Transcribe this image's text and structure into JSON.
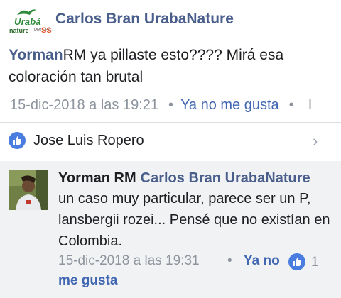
{
  "header": {
    "logo": {
      "word1": "Urabá",
      "word2": "nature",
      "word3": "SS",
      "small": "PROJECT"
    },
    "author": "Carlos Bran UrabaNature"
  },
  "post": {
    "mention": "Yorman",
    "text": "RM ya pillaste esto???? Mirá esa coloración tan brutal",
    "timestamp": "15-dic-2018 a las 19:21",
    "separator": "•",
    "like_link": "Ya no me gusta",
    "cut_text": "I"
  },
  "reactors": {
    "name": "Jose Luis Ropero",
    "chevron": "›"
  },
  "reply": {
    "author": "Yorman RM",
    "page_mention": "Carlos Bran UrabaNature",
    "text": "un caso muy particular, parece ser un P, lansbergii rozei... Pensé que no existían en Colombia.",
    "timestamp": "15-dic-2018 a las 19:31",
    "separator": "•",
    "like_link_part1": "Ya no",
    "like_link_part2": "me gusta",
    "like_count": "1"
  },
  "colors": {
    "link": "#4267b2",
    "author": "#4a5e8c",
    "muted": "#8d949e",
    "like_badge": "#4a7de0",
    "reply_bg": "#f1f2f4"
  }
}
